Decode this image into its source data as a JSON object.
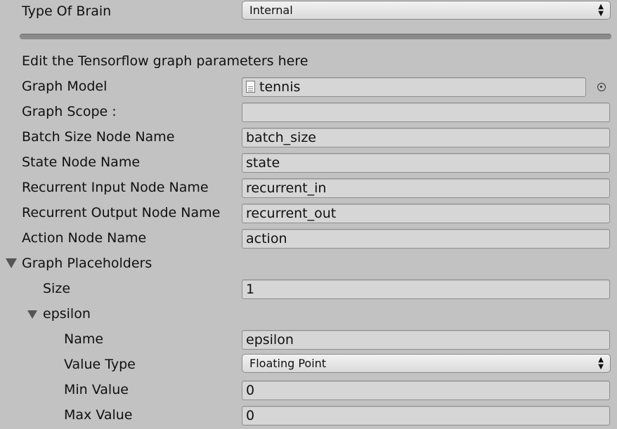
{
  "brain": {
    "type_label": "Type Of Brain",
    "type_value": "Internal"
  },
  "description": "Edit the Tensorflow graph parameters here",
  "graph_model": {
    "label": "Graph Model",
    "value": "tennis"
  },
  "graph_scope": {
    "label": "Graph Scope :",
    "value": ""
  },
  "batch_size_node": {
    "label": "Batch Size Node Name",
    "value": "batch_size"
  },
  "state_node": {
    "label": "State Node Name",
    "value": "state"
  },
  "recurrent_input_node": {
    "label": "Recurrent Input Node Name",
    "value": "recurrent_in"
  },
  "recurrent_output_node": {
    "label": "Recurrent Output Node Name",
    "value": "recurrent_out"
  },
  "action_node": {
    "label": "Action Node Name",
    "value": "action"
  },
  "placeholders": {
    "label": "Graph Placeholders",
    "size_label": "Size",
    "size_value": "1",
    "item": {
      "label": "epsilon",
      "name_label": "Name",
      "name_value": "epsilon",
      "value_type_label": "Value Type",
      "value_type_value": "Floating Point",
      "min_label": "Min Value",
      "min_value": "0",
      "max_label": "Max Value",
      "max_value": "0"
    }
  },
  "icons": {
    "dropdown_arrows": "updown-arrows-icon",
    "model_file": "file-icon",
    "object_picker": "target-icon",
    "foldout_expanded": "triangle-down-icon"
  }
}
